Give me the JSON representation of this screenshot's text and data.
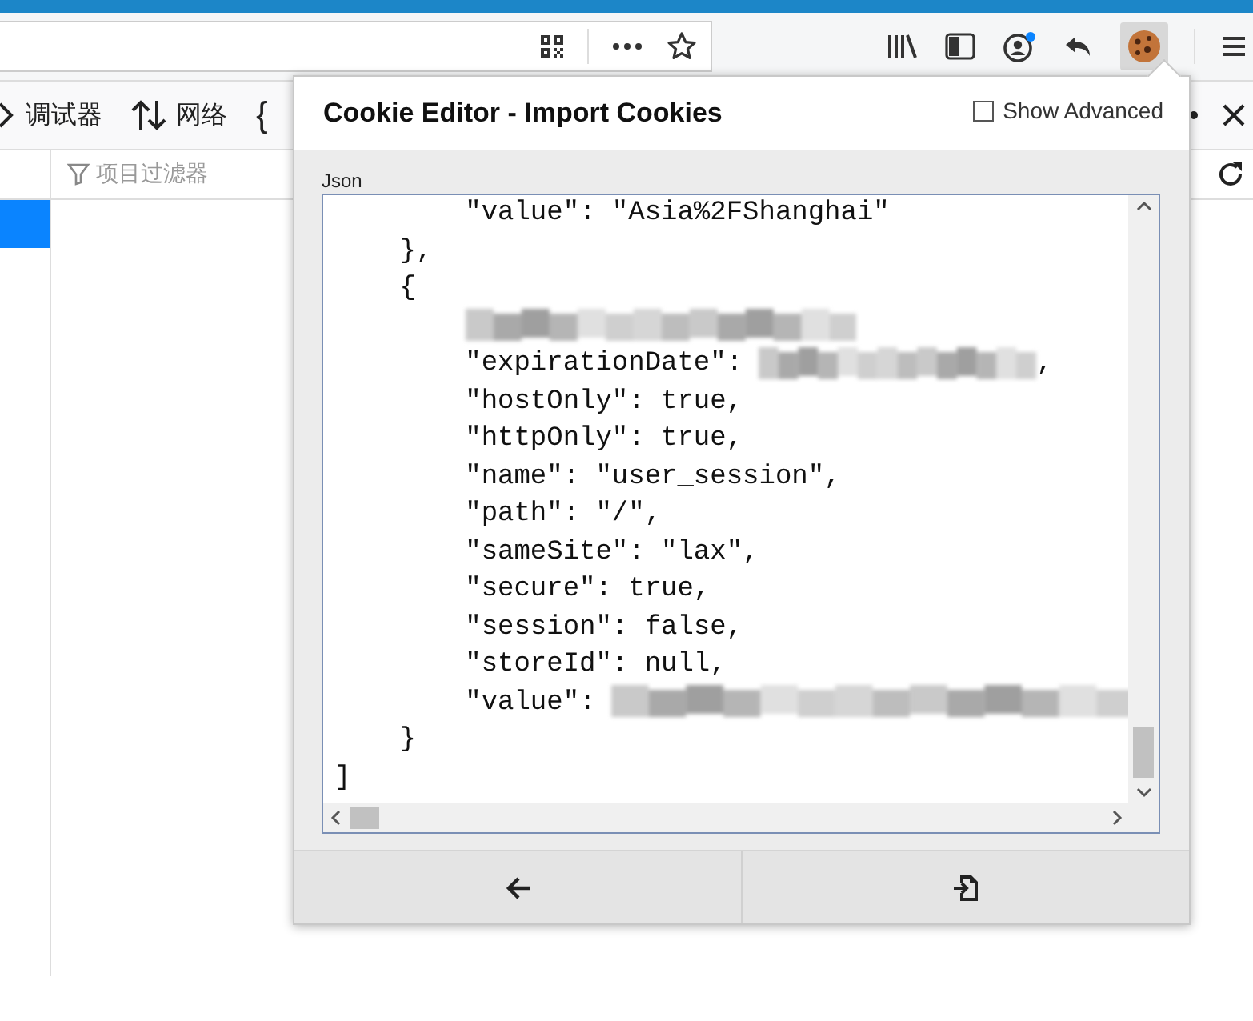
{
  "devtools": {
    "tabs": [
      {
        "label": "调试器"
      },
      {
        "label": "网络"
      },
      {
        "label": "{"
      }
    ],
    "filter": {
      "placeholder": "项目过滤器"
    }
  },
  "popup": {
    "title": "Cookie Editor - Import Cookies",
    "show_advanced": {
      "label": "Show Advanced",
      "checked": false
    },
    "json_label": "Json",
    "lines": [
      {
        "kind": "code",
        "text": "        \"value\": \"Asia%2FShanghai\""
      },
      {
        "kind": "code",
        "text": "    },"
      },
      {
        "kind": "code",
        "text": "    {"
      },
      {
        "kind": "redacted"
      },
      {
        "kind": "code",
        "text": "        \"expirationDate\": ",
        "redacted": true,
        "tail": ","
      },
      {
        "kind": "code",
        "text": "        \"hostOnly\": true,"
      },
      {
        "kind": "code",
        "text": "        \"httpOnly\": true,"
      },
      {
        "kind": "code",
        "text": "        \"name\": \"user_session\","
      },
      {
        "kind": "code",
        "text": "        \"path\": \"/\","
      },
      {
        "kind": "code",
        "text": "        \"sameSite\": \"lax\","
      },
      {
        "kind": "code",
        "text": "        \"secure\": true,"
      },
      {
        "kind": "code",
        "text": "        \"session\": false,"
      },
      {
        "kind": "code",
        "text": "        \"storeId\": null,"
      },
      {
        "kind": "code",
        "text": "        \"value\": ",
        "redacted": true
      },
      {
        "kind": "code",
        "text": "    }"
      },
      {
        "kind": "code",
        "text": "]"
      }
    ]
  }
}
